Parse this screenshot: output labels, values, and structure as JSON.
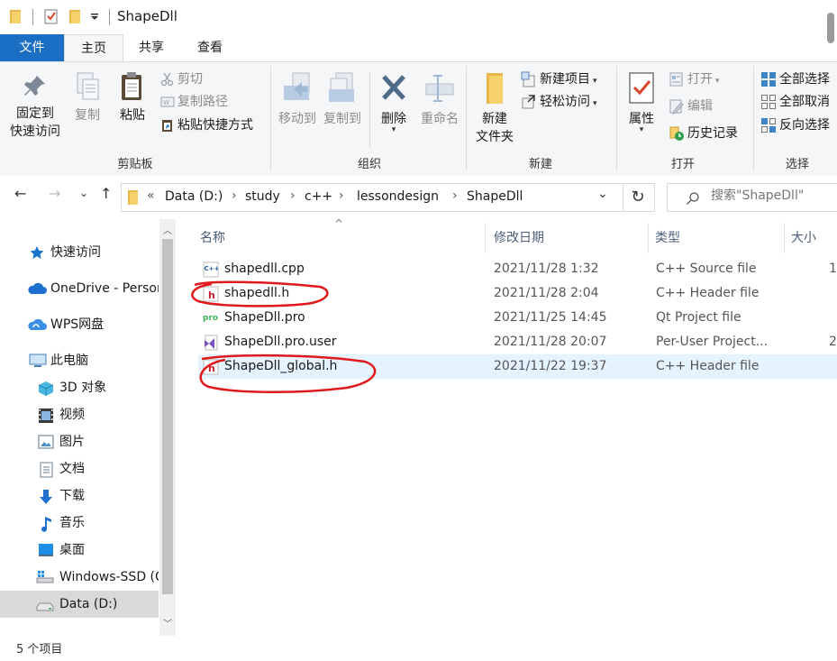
{
  "window": {
    "title": "ShapeDll"
  },
  "ribbon_tabs": [
    {
      "label": "文件"
    },
    {
      "label": "主页"
    },
    {
      "label": "共享"
    },
    {
      "label": "查看"
    }
  ],
  "clipboard": {
    "title": "剪贴板",
    "pin_line1": "固定到",
    "pin_line2": "快速访问",
    "copy": "复制",
    "paste": "粘贴",
    "cut": "剪切",
    "copy_path": "复制路径",
    "paste_shortcut": "粘贴快捷方式"
  },
  "organize": {
    "title": "组织",
    "move_to": "移动到",
    "copy_to": "复制到",
    "delete": "删除",
    "rename": "重命名"
  },
  "new_group": {
    "title": "新建",
    "new_folder_line1": "新建",
    "new_folder_line2": "文件夹",
    "new_item": "新建项目",
    "easy_access": "轻松访问"
  },
  "open_group": {
    "title": "打开",
    "properties": "属性",
    "open": "打开",
    "edit": "编辑",
    "history": "历史记录"
  },
  "select_group": {
    "title": "选择",
    "select_all": "全部选择",
    "select_none": "全部取消",
    "invert": "反向选择"
  },
  "address": {
    "overflow": "«",
    "crumbs": [
      "Data (D:)",
      "study",
      "c++",
      "lessondesign",
      "ShapeDll"
    ],
    "sep": "›"
  },
  "search": {
    "placeholder": "搜索\"ShapeDll\""
  },
  "nav_pane": [
    {
      "label": "快速访问"
    },
    {
      "label": "OneDrive - Personal"
    },
    {
      "label": "WPS网盘"
    },
    {
      "label": "此电脑"
    },
    {
      "label": "3D 对象"
    },
    {
      "label": "视频"
    },
    {
      "label": "图片"
    },
    {
      "label": "文档"
    },
    {
      "label": "下载"
    },
    {
      "label": "音乐"
    },
    {
      "label": "桌面"
    },
    {
      "label": "Windows-SSD (C:)"
    },
    {
      "label": "Data (D:)"
    }
  ],
  "columns": {
    "name": "名称",
    "date": "修改日期",
    "type": "类型",
    "size": "大小"
  },
  "files": [
    {
      "name": "shapedll.cpp",
      "date": "2021/11/28 1:32",
      "type": "C++ Source file",
      "size": "1"
    },
    {
      "name": "shapedll.h",
      "date": "2021/11/28 2:04",
      "type": "C++ Header file",
      "size": ""
    },
    {
      "name": "ShapeDll.pro",
      "date": "2021/11/25 14:45",
      "type": "Qt Project file",
      "size": ""
    },
    {
      "name": "ShapeDll.pro.user",
      "date": "2021/11/28 20:07",
      "type": "Per-User Project...",
      "size": "2"
    },
    {
      "name": "ShapeDll_global.h",
      "date": "2021/11/22 19:37",
      "type": "C++ Header file",
      "size": ""
    }
  ],
  "icon_labels": {
    "cpp": "C++",
    "header": "h",
    "qt": "pro"
  },
  "status": {
    "text": "5 个项目"
  },
  "colors": {
    "accent": "#1a6fc4",
    "annotation": "#e0191b",
    "selected_row": "#e5f3ff"
  }
}
